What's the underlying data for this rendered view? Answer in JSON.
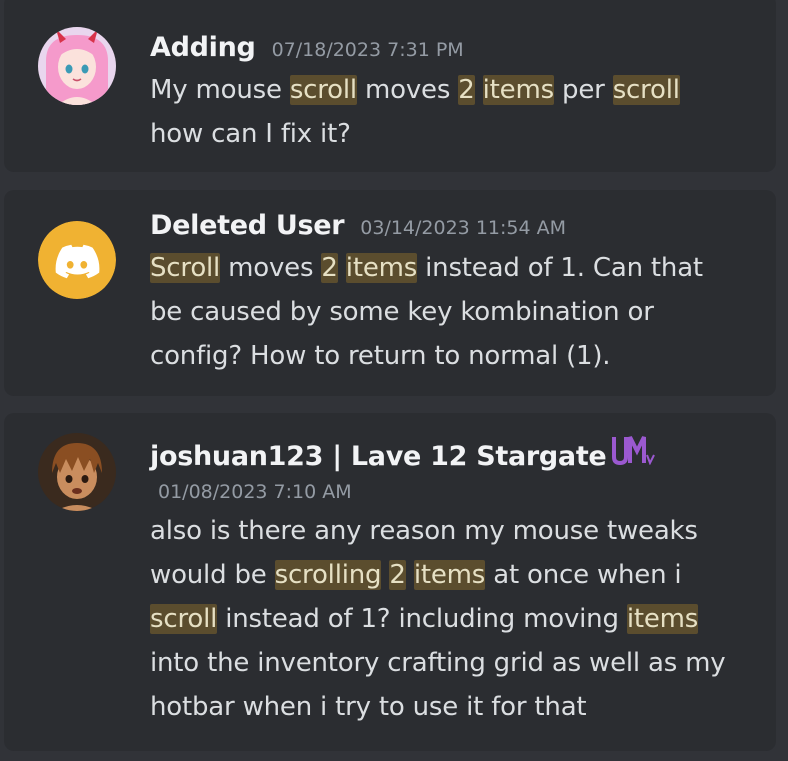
{
  "results": [
    {
      "username": "Adding",
      "timestamp": "07/18/2023 7:31 PM",
      "avatar": "anime-girl-pink-hair-avatar",
      "segments": [
        {
          "text": "My mouse ",
          "hl": false
        },
        {
          "text": "scroll",
          "hl": true
        },
        {
          "text": " moves ",
          "hl": false
        },
        {
          "text": "2",
          "hl": true
        },
        {
          "text": " ",
          "hl": false
        },
        {
          "text": "items",
          "hl": true
        },
        {
          "text": " per ",
          "hl": false
        },
        {
          "text": "scroll",
          "hl": true
        },
        {
          "text": " how can I fix it?",
          "hl": false
        }
      ]
    },
    {
      "username": "Deleted User",
      "timestamp": "03/14/2023 11:54 AM",
      "avatar": "discord-default-avatar-icon",
      "avatar_color": "#f0b232",
      "segments": [
        {
          "text": "Scroll",
          "hl": true
        },
        {
          "text": " moves ",
          "hl": false
        },
        {
          "text": "2",
          "hl": true
        },
        {
          "text": " ",
          "hl": false
        },
        {
          "text": "items",
          "hl": true
        },
        {
          "text": " instead of 1. Can that be caused by some key kombination or config? How to return to normal (1).",
          "hl": false
        }
      ]
    },
    {
      "username": "joshuan123 | Lave 12 Stargate",
      "timestamp": "01/08/2023 7:10 AM",
      "avatar": "anime-boy-brown-hair-avatar",
      "role_tag": "UM-purple-badge",
      "segments": [
        {
          "text": "also is there any reason my mouse tweaks would be ",
          "hl": false
        },
        {
          "text": "scrolling",
          "hl": true
        },
        {
          "text": " ",
          "hl": false
        },
        {
          "text": "2",
          "hl": true
        },
        {
          "text": " ",
          "hl": false
        },
        {
          "text": "items",
          "hl": true
        },
        {
          "text": " at once when i ",
          "hl": false
        },
        {
          "text": "scroll",
          "hl": true
        },
        {
          "text": " instead of 1? including moving ",
          "hl": false
        },
        {
          "text": "items",
          "hl": true
        },
        {
          "text": " into the inventory crafting grid as well as my hotbar when i try to use it for that",
          "hl": false
        }
      ]
    }
  ],
  "colors": {
    "background": "#313338",
    "card": "#2b2d31",
    "highlight": "#5b4d2e",
    "username": "#f2f3f5",
    "timestamp": "#949ba4",
    "text": "#dbdee1"
  }
}
